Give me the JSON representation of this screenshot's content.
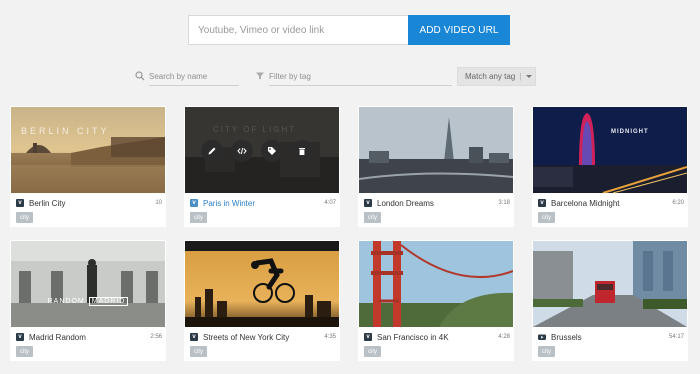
{
  "add_url": {
    "placeholder": "Youtube, Vimeo or video link",
    "button_label": "ADD VIDEO URL",
    "button_color": "#1a86d6"
  },
  "filters": {
    "search_placeholder": "Search by name",
    "tag_placeholder": "Filter by tag",
    "match_label": "Match any tag",
    "match_separator": "|"
  },
  "videos": [
    {
      "title": "Berlin City",
      "duration": "10",
      "source": "vimeo-icon",
      "tag": "city",
      "overlay_text": "BERLIN CITY"
    },
    {
      "title": "Paris in Winter",
      "duration": "4:07",
      "source": "vimeo-icon",
      "tag": "city",
      "overlay_text": "CITY OF LIGHT"
    },
    {
      "title": "London Dreams",
      "duration": "3:18",
      "source": "vimeo-icon",
      "tag": "city"
    },
    {
      "title": "Barcelona Midnight",
      "duration": "6:20",
      "source": "vimeo-icon",
      "tag": "city",
      "overlay_text": "MIDNIGHT"
    },
    {
      "title": "Madrid Random",
      "duration": "2:56",
      "source": "vimeo-icon",
      "tag": "city",
      "overlay_text_a": "RANDOM",
      "overlay_text_b": "MADRID"
    },
    {
      "title": "Streets of New York City",
      "duration": "4:35",
      "source": "vimeo-icon",
      "tag": "city"
    },
    {
      "title": "San Francisco in 4K",
      "duration": "4:28",
      "source": "vimeo-icon",
      "tag": "city"
    },
    {
      "title": "Brussels",
      "duration": "54:17",
      "source": "youtube-icon",
      "tag": "city"
    }
  ],
  "hover_actions": [
    "edit-icon",
    "embed-code-icon",
    "tag-icon",
    "trash-icon"
  ],
  "active_title_color": "#2a7fc4"
}
